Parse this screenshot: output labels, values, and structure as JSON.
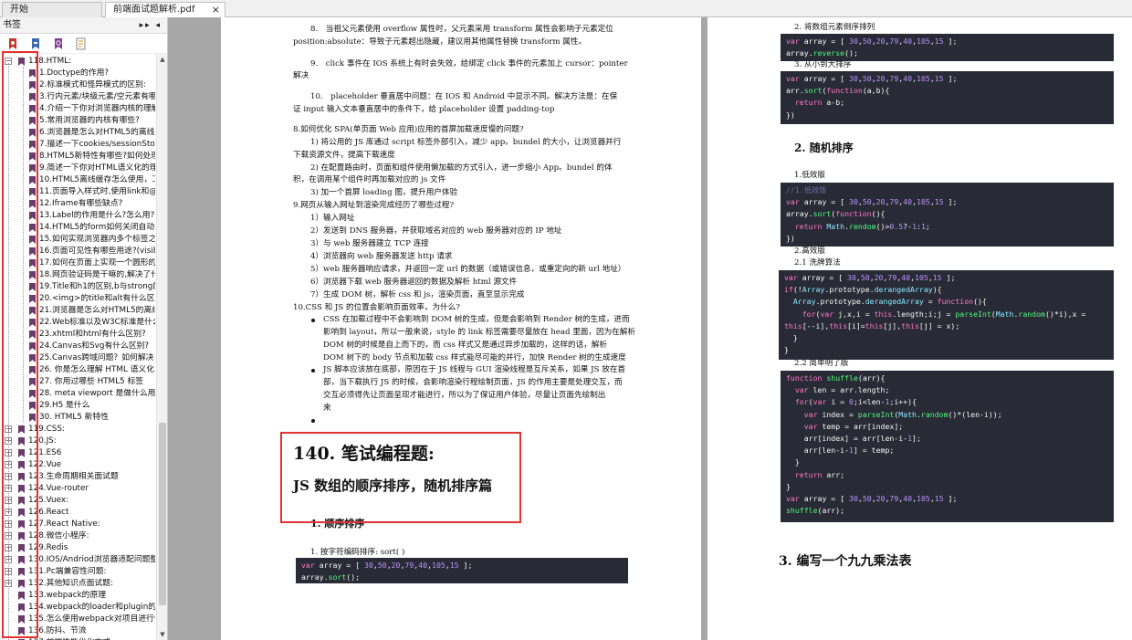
{
  "tabs": [
    {
      "label": "开始"
    },
    {
      "label": "前端面试题解析.pdf",
      "close": "×"
    }
  ],
  "sidebar": {
    "title": "书签",
    "controls": "▸▸ ◂",
    "tools": [
      "bookmark-expand-icon",
      "bookmark-collapse-icon",
      "bookmark-find-icon",
      "bookmark-options-icon"
    ],
    "items": [
      "118.HTML:",
      "1.Doctype的作用?",
      "2.标准模式和怪异模式的区别:",
      "3.行内元素/块级元素/空元素有哪",
      "4.介绍一下你对浏览器内核的理解",
      "5.常用浏览器的内核有哪些?",
      "6.浏览器是怎么对HTML5的离线",
      "7.描述一下cookies/sessionStora",
      "8.HTML5新特性有哪些?如何处理",
      "9.简述一下你对HTML语义化的理",
      "10.HTML5离线缓存怎么使用，工",
      "11.页面导入样式时,使用link和@i",
      "12.Iframe有哪些缺点?",
      "13.Label的作用是什么?怎么用?",
      "14.HTML5的form如何关闭自动",
      "15.如何实现浏览器内多个标签之",
      "16.页面可见性有哪些用途?(visib",
      "17.如何在页面上实现一个圆形的",
      "18.网页验证码是干嘛的,解决了什",
      "19.Title和h1的区别,b与strong的",
      "20.<img>的title和alt有什么区别",
      "21.浏览器是怎么对HTML5的离线",
      "22.Web标准以及W3C标准是什么",
      "23.xhtml和html有什么区别?",
      "24.Canvas和Svg有什么区别?",
      "25.Canvas跨域问题？如何解决",
      "26. 你是怎么理解 HTML 语义化",
      "27. 你用过哪些 HTML5 标签",
      "28. meta viewport 是做什么用的",
      "29.H5 是什么",
      "30. HTML5 新特性",
      "119.CSS:",
      "120.JS:",
      "121.ES6",
      "122.Vue",
      "123.生命周期相关面试题",
      "124.Vue-router",
      "125.Vuex:",
      "126.React",
      "127.React Native:",
      "128.微信小程序:",
      "129.Redis",
      "130.IOS/Andriod浏览器适配问题整理",
      "131.Pc端兼容性问题:",
      "132.其他知识点面试题:",
      "133.webpack的原理",
      "134.webpack的loader和plugin的区别",
      "135.怎么使用webpack对项目进行优化",
      "136.防抖、节流",
      "137.前端性能优化方式"
    ]
  },
  "page1": {
    "lines": [
      "8.　当祖父元素使用 overflow 属性时，父元素采用 transform 属性会影响子元素定位",
      "position:absolute：导致子元素超出隐藏，建议用其他属性替换 transform 属性。",
      "9.　click 事件在 IOS 系统上有时会失效，给绑定 click 事件的元素加上 cursor：pointer",
      "解决",
      "10.　placeholder 垂直居中问题：在 IOS 和 Android 中显示不同。解决方法是：在保",
      "证 input 输入文本垂直居中的条件下，给 placeholder 设置 padding-top",
      "8.如何优化 SPA(单页面 Web 应用)应用的首屏加载速度慢的问题?",
      "1) 将公用的 JS 库通过 script 标签外部引入，减少 app。bundel 的大小，让浏览器并行",
      "下载资源文件，提高下载速度",
      "2) 在配置路由时，页面和组件使用懒加载的方式引入，进一步缩小 App。bundel 的体",
      "积，在调用某个组件时再加载对应的 js 文件",
      "3) 加一个首屏 loading 图，提升用户体验",
      "9.网页从输入网址到渲染完成经历了哪些过程?",
      "1）输入网址",
      "2）发送到 DNS 服务器，并获取域名对应的 web 服务器对应的 IP 地址",
      "3）与 web 服务器建立 TCP 连接",
      "4）浏览器向 web 服务器发送 http 请求",
      "5）web 服务器响应请求，并返回一定 url 的数据（或错误信息，或重定向的新 url 地址）",
      "6）浏览器下载 web 服务器返回的数据及解析 html 源文件",
      "7）生成 DOM 树，解析 css 和 js，渲染页面，直至显示完成",
      "10.CSS 和 JS 的位置会影响页面效率，为什么?",
      "CSS 在加载过程中不会影响到 DOM 树的生成，但是会影响到 Render 树的生成，进而",
      "影响到 layout，所以一般来说，style 的 link 标签需要尽量放在 head 里面，因为在解析",
      "DOM 树的时候是自上而下的，而 css 样式又是通过异步加载的，这样的话，解析",
      "DOM 树下的 body 节点和加载 css 样式能尽可能的并行，加快 Render 树的生成速度",
      "JS 脚本应该放在底部，原因在于 JS 线程与 GUI 渲染线程是互斥关系，如果 JS 放在首",
      "部，当下载执行 JS 的时候，会影响渲染行程绘制页面，JS 的作用主要是处理交互，而",
      "交互必须得先让页面呈现才能进行，所以为了保证用户体验，尽量让页面先绘制出",
      "来"
    ],
    "heading": "140. 笔试编程题:",
    "subheading": "JS 数组的顺序排序，随机排序篇",
    "section1": "1. 顺序排序",
    "item1": "1. 按字符编码排序: sort( )"
  },
  "page2": {
    "item2": "2. 将数组元素倒序排列",
    "item3": "3. 从小到大排序",
    "section2": "2. 随机排序",
    "low": "1.低效版",
    "high": "2.高效版",
    "shuffle": "2.1 洗牌算法",
    "simple": "2.2 简单明了版",
    "section3": "3. 编写一个九九乘法表"
  },
  "colors": {
    "highlight": "#e33232",
    "code_bg": "#282a36"
  }
}
